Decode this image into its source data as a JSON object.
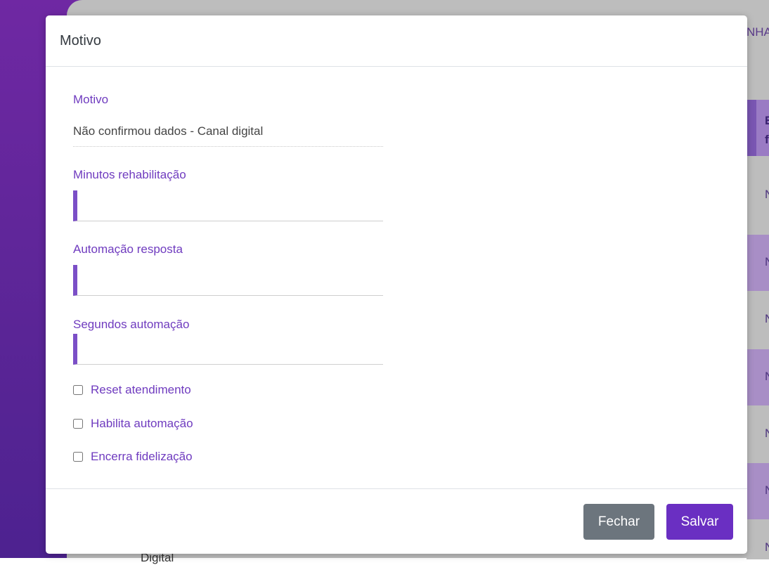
{
  "background": {
    "header_fragment": "NHA",
    "rows": [
      {
        "text": "E f",
        "style": "head"
      },
      {
        "text": "N",
        "style": "light"
      },
      {
        "text": "N",
        "style": "tint"
      },
      {
        "text": "N",
        "style": "light"
      },
      {
        "text": "N",
        "style": "tint"
      },
      {
        "text": "N",
        "style": "light"
      },
      {
        "text": "N",
        "style": "tint"
      },
      {
        "text": "N",
        "style": "light"
      }
    ],
    "bottom_fragment": "Digital"
  },
  "modal": {
    "title": "Motivo",
    "fields": {
      "motivo": {
        "label": "Motivo",
        "value": "Não confirmou dados - Canal digital"
      },
      "minutos_rehabilitacao": {
        "label": "Minutos rehabilitação",
        "value": ""
      },
      "automacao_resposta": {
        "label": "Automação resposta",
        "value": ""
      },
      "segundos_automacao": {
        "label": "Segundos automação",
        "value": ""
      }
    },
    "checkboxes": {
      "reset_atendimento": {
        "label": "Reset atendimento",
        "checked": false
      },
      "habilita_automacao": {
        "label": "Habilita automação",
        "checked": false
      },
      "encerra_fidelizacao": {
        "label": "Encerra fidelização",
        "checked": false
      }
    },
    "footer": {
      "close_label": "Fechar",
      "save_label": "Salvar"
    }
  },
  "colors": {
    "accent": "#6a2fc2",
    "label": "#6f3bbf",
    "close_button": "#6c757d"
  }
}
